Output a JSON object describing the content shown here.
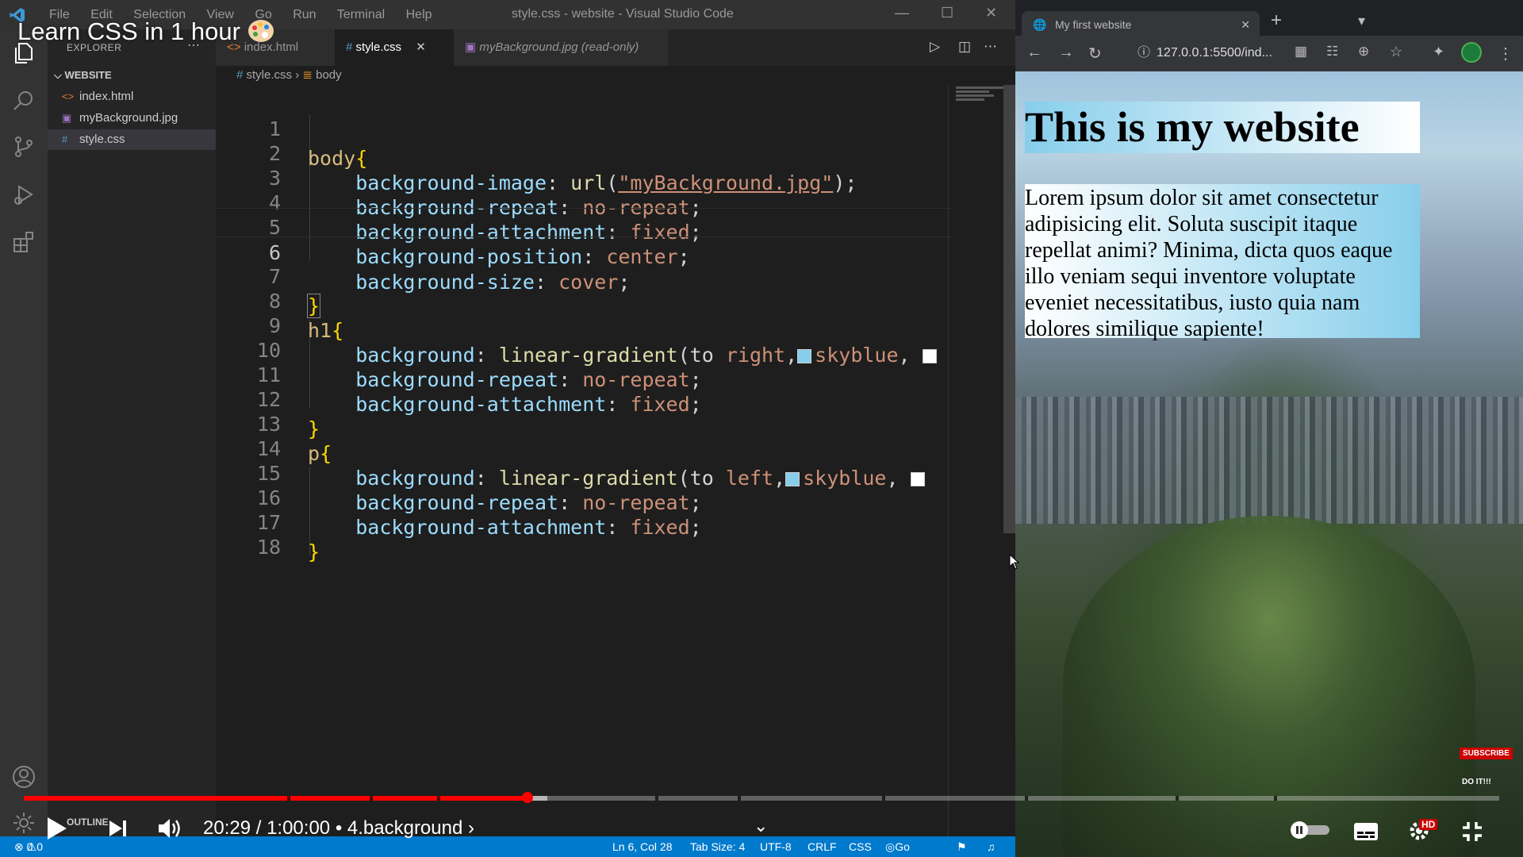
{
  "video": {
    "title": "Learn CSS in 1 hour",
    "time": "20:29 / 1:00:00",
    "chapter": "• 4.background",
    "progress_fraction": 0.3415,
    "subscribe_label": "SUBSCRIBE",
    "doit_label": "DO IT!!!",
    "hd_badge": "HD"
  },
  "vscode": {
    "window_title": "style.css - website - Visual Studio Code",
    "menu": [
      "File",
      "Edit",
      "Selection",
      "View",
      "Go",
      "Run",
      "Terminal",
      "Help"
    ],
    "explorer_title": "EXPLORER",
    "folder": "WEBSITE",
    "files": [
      {
        "name": "index.html",
        "icon": "<>"
      },
      {
        "name": "myBackground.jpg",
        "icon": "▣"
      },
      {
        "name": "style.css",
        "icon": "#"
      }
    ],
    "outline_label": "OUTLINE",
    "tabs": [
      {
        "label": "index.html"
      },
      {
        "label": "style.css"
      },
      {
        "label": "myBackground.jpg (read-only)"
      }
    ],
    "breadcrumb": {
      "file": "style.css",
      "symbol": "body"
    },
    "code_lines": [
      "body{",
      "    background-image: url(\"myBackground.jpg\");",
      "    background-repeat: no-repeat;",
      "    background-attachment: fixed;",
      "    background-position: center;",
      "    background-size: cover;",
      "}",
      "h1{",
      "    background: linear-gradient(to right, skyblue,",
      "    background-repeat: no-repeat;",
      "    background-attachment: fixed;",
      "}",
      "p{",
      "    background: linear-gradient(to left, skyblue,",
      "    background-repeat: no-repeat;",
      "    background-attachment: fixed;",
      "}",
      ""
    ],
    "current_line": 6,
    "status": {
      "errors": "0",
      "warnings": "0",
      "position": "Ln 6, Col 28",
      "tab_size": "Tab Size: 4",
      "encoding": "UTF-8",
      "eol": "CRLF",
      "language": "CSS",
      "go_live": "Go Live"
    },
    "colors": {
      "status_bar": "#007acc",
      "activity_bar": "#333333",
      "editor_bg": "#1e1e1e"
    }
  },
  "browser": {
    "tab_title": "My first website",
    "url": "127.0.0.1:5500/ind...",
    "page_h1": "This is my website",
    "page_p": "Lorem ipsum dolor sit amet consectetur adipisicing elit. Soluta suscipit itaque repellat animi? Minima, dicta quos eaque illo veniam sequi inventore voluptate eveniet necessitatibus, iusto quia nam dolores similique sapiente!"
  }
}
